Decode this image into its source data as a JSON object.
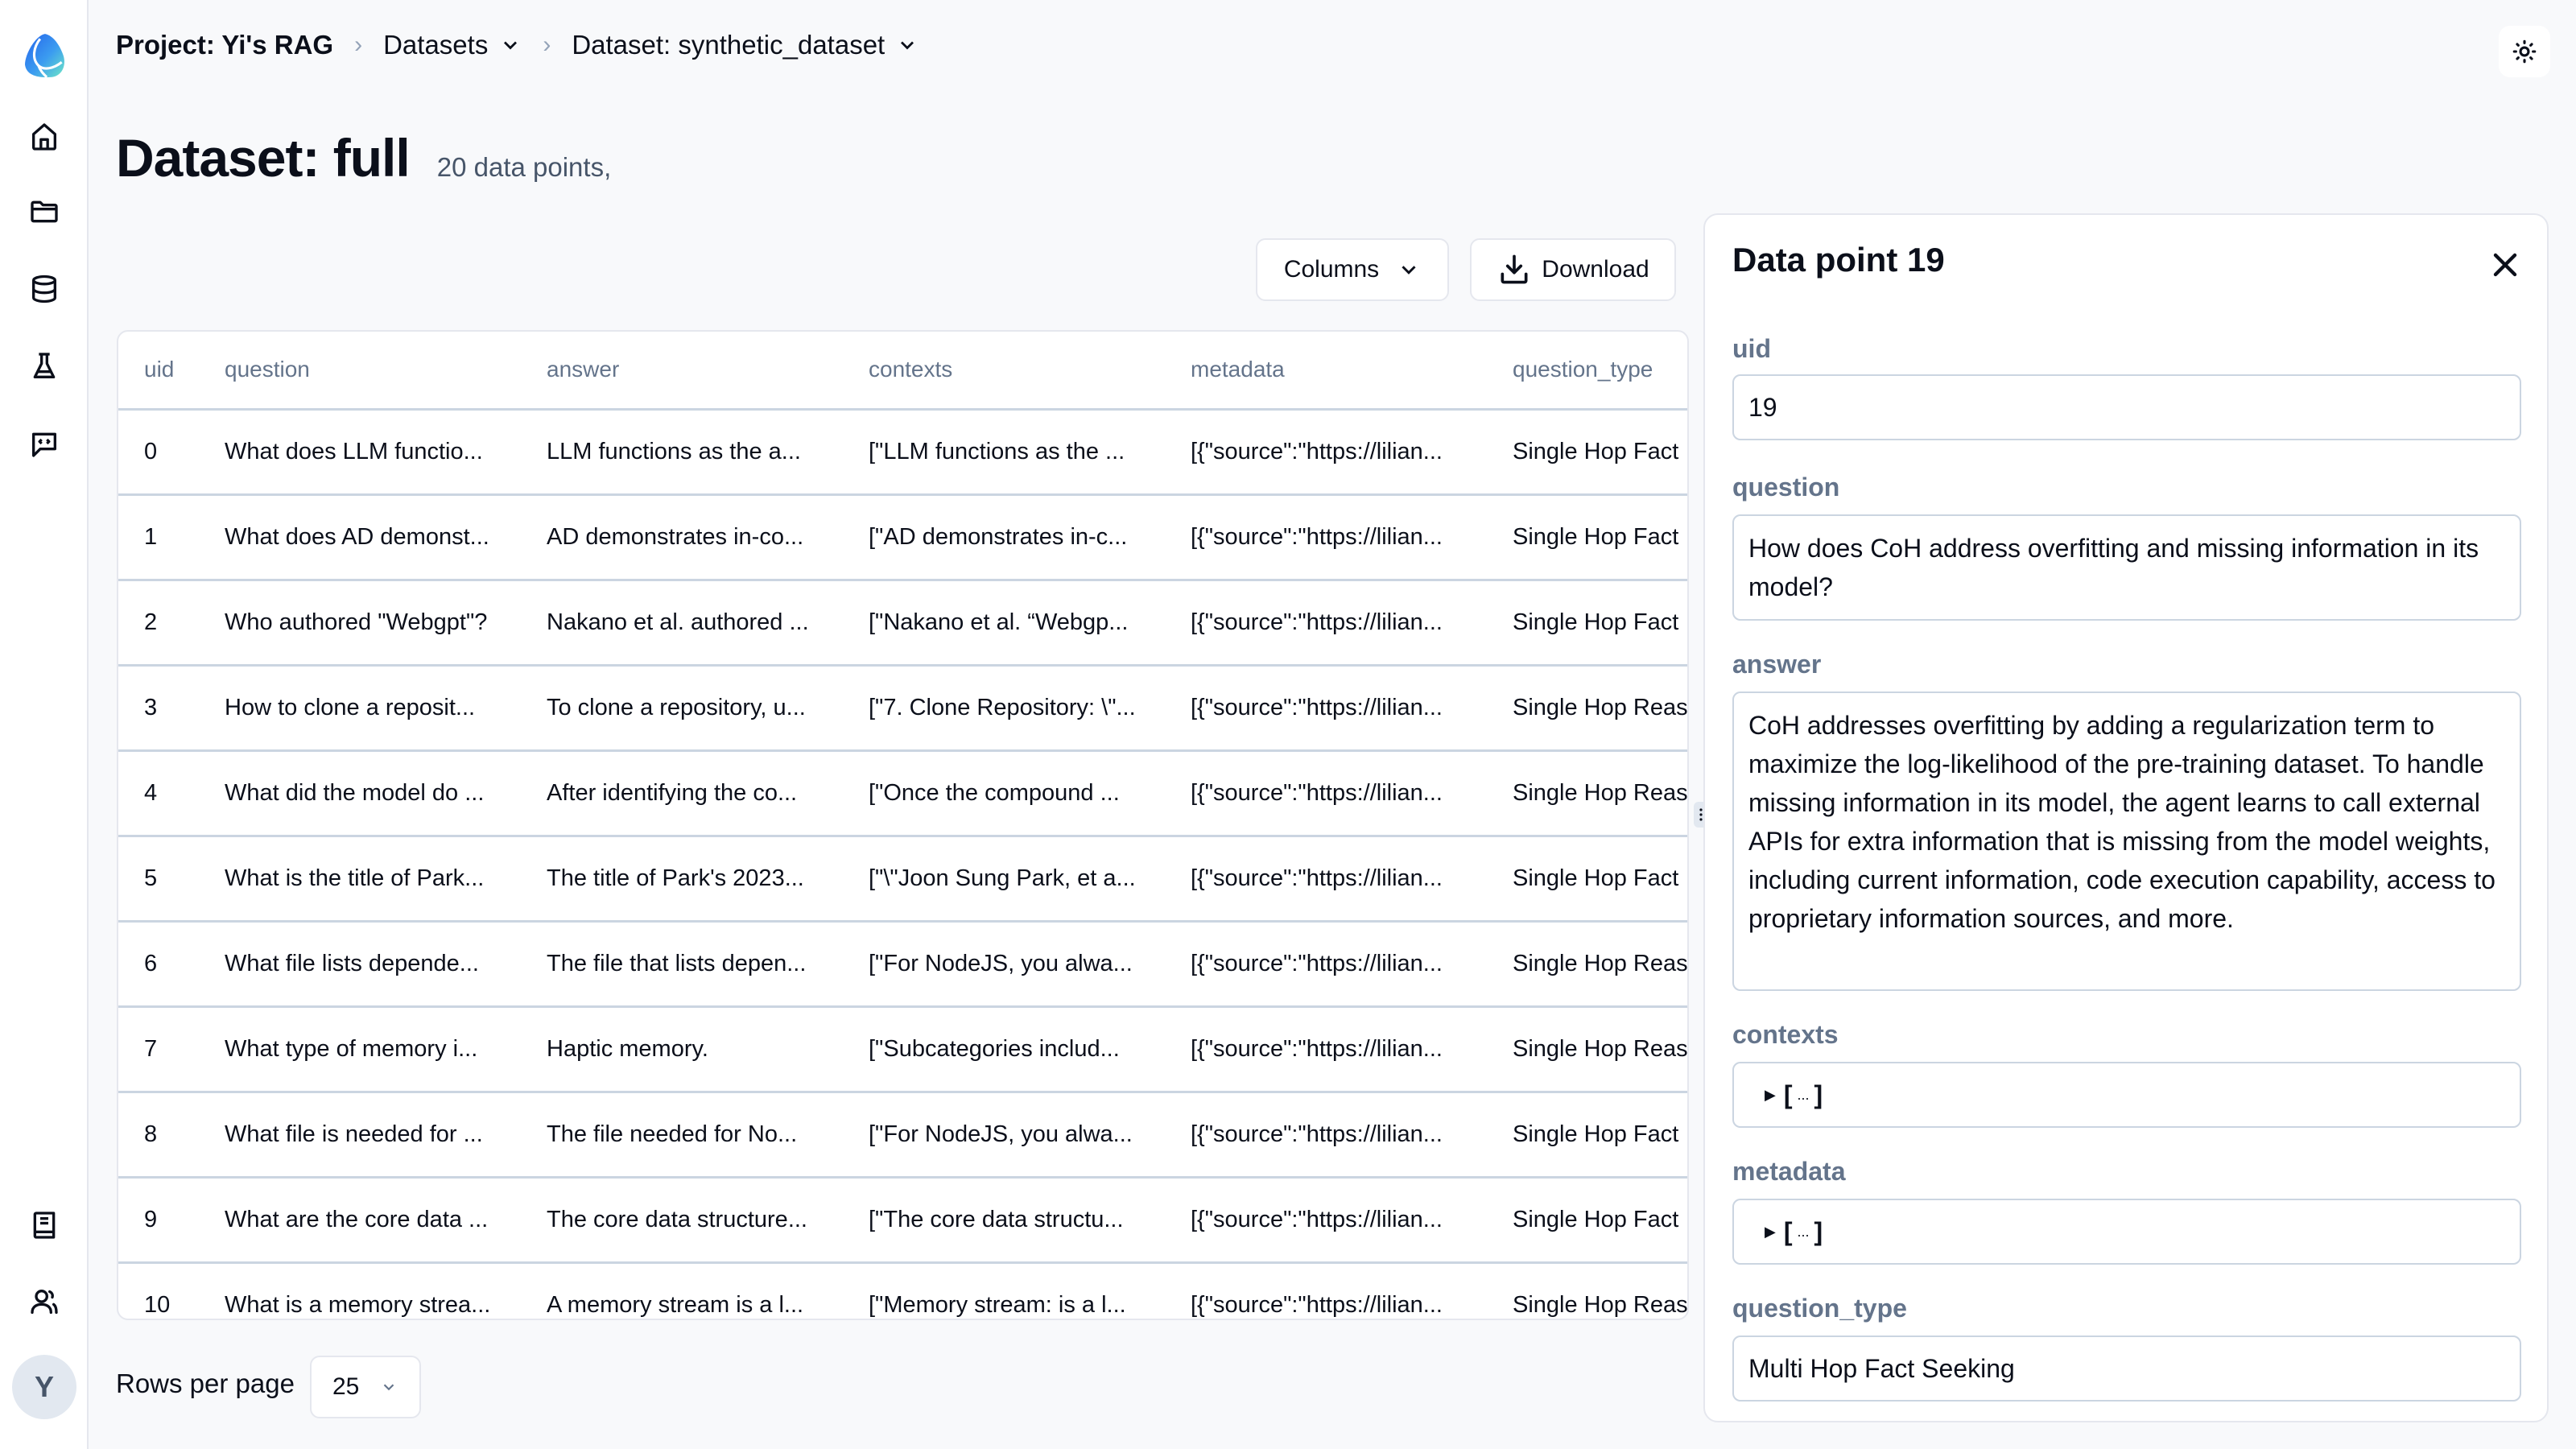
{
  "sidebar": {
    "items": [
      {
        "name": "home",
        "icon": "home-icon"
      },
      {
        "name": "projects",
        "icon": "folder-icon"
      },
      {
        "name": "datasets",
        "icon": "database-icon"
      },
      {
        "name": "experiments",
        "icon": "flask-icon"
      },
      {
        "name": "feedback",
        "icon": "message-code-icon"
      }
    ],
    "bottom_items": [
      {
        "name": "docs",
        "icon": "book-icon"
      },
      {
        "name": "team",
        "icon": "users-icon"
      }
    ],
    "avatar_initial": "Y"
  },
  "breadcrumb": {
    "project": "Project: Yi's RAG",
    "section": "Datasets",
    "dataset": "Dataset: synthetic_dataset"
  },
  "header": {
    "title": "Dataset: full",
    "subtitle": "20 data points,"
  },
  "toolbar": {
    "columns_label": "Columns",
    "download_label": "Download"
  },
  "table": {
    "columns": [
      "uid",
      "question",
      "answer",
      "contexts",
      "metadata",
      "question_type"
    ],
    "rows": [
      [
        "0",
        "What does LLM functio...",
        "LLM functions as the a...",
        "[\"LLM functions as the ...",
        "[{\"source\":\"https://lilian...",
        "Single Hop Fact"
      ],
      [
        "1",
        "What does AD demonst...",
        "AD demonstrates in-co...",
        "[\"AD demonstrates in-c...",
        "[{\"source\":\"https://lilian...",
        "Single Hop Fact"
      ],
      [
        "2",
        "Who authored \"Webgpt\"?",
        "Nakano et al. authored ...",
        "[\"Nakano et al. “Webgp...",
        "[{\"source\":\"https://lilian...",
        "Single Hop Fact"
      ],
      [
        "3",
        "How to clone a reposit...",
        "To clone a repository, u...",
        "[\"7. Clone Repository: \\\"...",
        "[{\"source\":\"https://lilian...",
        "Single Hop Reas"
      ],
      [
        "4",
        "What did the model do ...",
        "After identifying the co...",
        "[\"Once the compound ...",
        "[{\"source\":\"https://lilian...",
        "Single Hop Reas"
      ],
      [
        "5",
        "What is the title of Park...",
        "The title of Park's 2023...",
        "[\"\\\"Joon Sung Park, et a...",
        "[{\"source\":\"https://lilian...",
        "Single Hop Fact"
      ],
      [
        "6",
        "What file lists depende...",
        "The file that lists depen...",
        "[\"For NodeJS, you alwa...",
        "[{\"source\":\"https://lilian...",
        "Single Hop Reas"
      ],
      [
        "7",
        "What type of memory i...",
        "Haptic memory.",
        "[\"Subcategories includ...",
        "[{\"source\":\"https://lilian...",
        "Single Hop Reas"
      ],
      [
        "8",
        "What file is needed for ...",
        "The file needed for No...",
        "[\"For NodeJS, you alwa...",
        "[{\"source\":\"https://lilian...",
        "Single Hop Fact"
      ],
      [
        "9",
        "What are the core data ...",
        "The core data structure...",
        "[\"The core data structu...",
        "[{\"source\":\"https://lilian...",
        "Single Hop Fact"
      ],
      [
        "10",
        "What is a memory strea...",
        "A memory stream is a l...",
        "[\"Memory stream: is a l...",
        "[{\"source\":\"https://lilian...",
        "Single Hop Reas"
      ]
    ]
  },
  "pagination": {
    "rows_per_page_label": "Rows per page",
    "rows_per_page_value": "25"
  },
  "detail": {
    "title": "Data point 19",
    "fields": {
      "uid": {
        "label": "uid",
        "value": "19"
      },
      "question": {
        "label": "question",
        "value": "How does CoH address overfitting and missing information in its model?"
      },
      "answer": {
        "label": "answer",
        "value": "CoH addresses overfitting by adding a regularization term to maximize the log-likelihood of the pre-training dataset. To handle missing information in its model, the agent learns to call external APIs for extra information that is missing from the model weights, including current information, code execution capability, access to proprietary information sources, and more."
      },
      "contexts": {
        "label": "contexts",
        "collapsed_open": "[",
        "collapsed_dots": "...",
        "collapsed_close": "]"
      },
      "metadata": {
        "label": "metadata",
        "collapsed_open": "[",
        "collapsed_dots": "...",
        "collapsed_close": "]"
      },
      "question_type": {
        "label": "question_type",
        "value": "Multi Hop Fact Seeking"
      }
    }
  }
}
